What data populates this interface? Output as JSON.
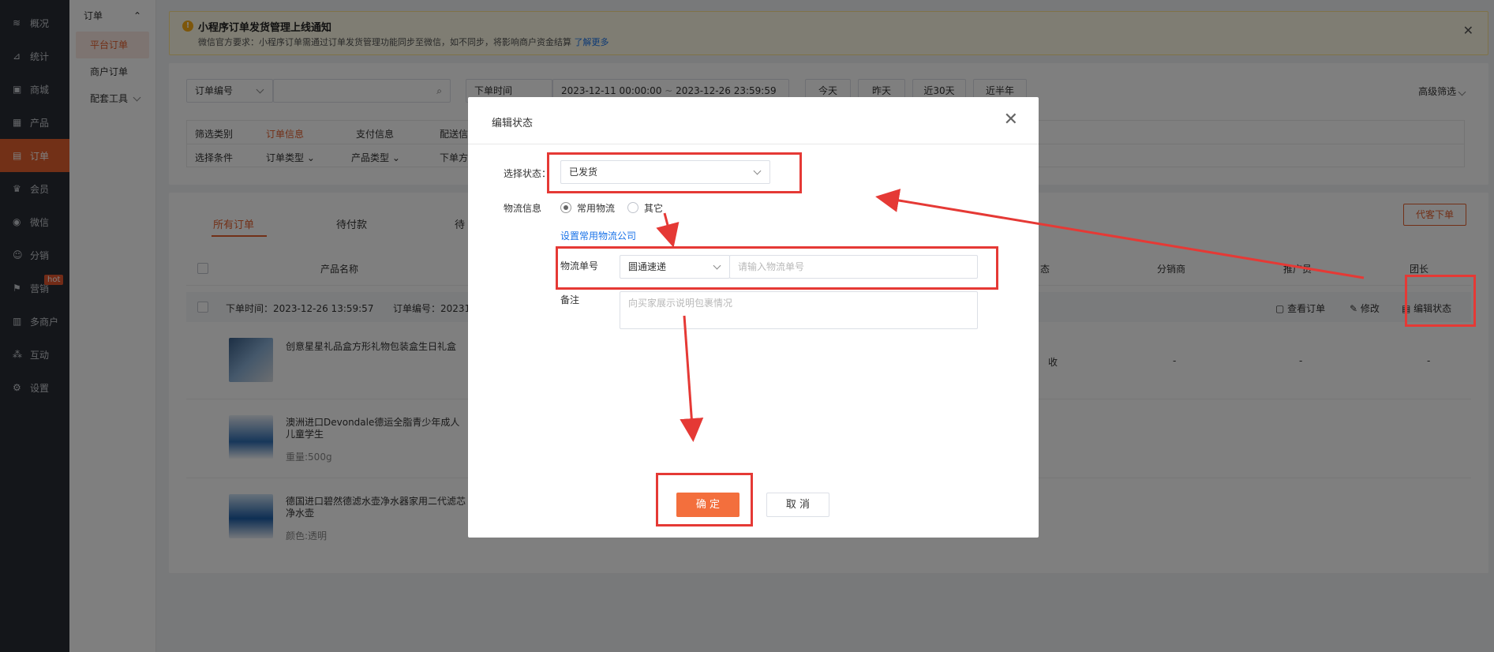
{
  "sidebar": {
    "items": [
      {
        "label": "概况",
        "icon": "layers-icon"
      },
      {
        "label": "统计",
        "icon": "chart-icon"
      },
      {
        "label": "商城",
        "icon": "shop-icon"
      },
      {
        "label": "产品",
        "icon": "grid-icon"
      },
      {
        "label": "订单",
        "icon": "order-icon"
      },
      {
        "label": "会员",
        "icon": "crown-icon"
      },
      {
        "label": "微信",
        "icon": "wechat-icon"
      },
      {
        "label": "分销",
        "icon": "user-share-icon"
      },
      {
        "label": "营销",
        "icon": "flag-icon"
      },
      {
        "label": "多商户",
        "icon": "store-icon"
      },
      {
        "label": "互动",
        "icon": "interact-icon"
      },
      {
        "label": "设置",
        "icon": "gear-icon"
      }
    ],
    "hot_badge": "hot"
  },
  "submenu": {
    "title": "订单",
    "items": [
      "平台订单",
      "商户订单",
      "配套工具"
    ]
  },
  "notice": {
    "title": "小程序订单发货管理上线通知",
    "desc": "微信官方要求：小程序订单需通过订单发货管理功能同步至微信，如不同步，将影响商户资金结算",
    "link": "了解更多"
  },
  "filters": {
    "order_field": "订单编号",
    "time_field": "下单时间",
    "date_start": "2023-12-11 00:00:00",
    "date_sep": "~",
    "date_end": "2023-12-26 23:59:59",
    "quick": [
      "今天",
      "昨天",
      "近30天",
      "近半年"
    ],
    "advanced": "高级筛选",
    "row1_label": "筛选类别",
    "row1_items": [
      "订单信息",
      "支付信息",
      "配送信"
    ],
    "row2_label": "选择条件",
    "row2_items": [
      "订单类型",
      "产品类型",
      "下单方"
    ]
  },
  "orders": {
    "tabs": [
      "所有订单",
      "待付款",
      "待"
    ],
    "proxy_order": "代客下单",
    "columns": [
      "产品名称",
      "态",
      "分销商",
      "推广员",
      "团长"
    ],
    "group_time": "下单时间：2023-12-26 13:59:57",
    "group_no": "订单编号：20231",
    "actions": [
      "查看订单",
      "修改",
      "编辑状态"
    ],
    "products": [
      {
        "name": "创意星星礼品盒方形礼物包装盒生日礼盒",
        "spec": ""
      },
      {
        "name": "澳洲进口Devondale德运全脂青少年成人儿童学生",
        "spec": "重量:500g"
      },
      {
        "name": "德国进口碧然德滤水壶净水器家用二代滤芯净水壶",
        "spec": "颜色:透明"
      }
    ],
    "row1_cells": [
      "收",
      "-",
      "-",
      "-"
    ]
  },
  "modal": {
    "title": "编辑状态",
    "status_label": "选择状态：",
    "status_value": "已发货",
    "logistics_label": "物流信息",
    "radio_common": "常用物流",
    "radio_other": "其它",
    "set_company_link": "设置常用物流公司",
    "tracking_label": "物流单号",
    "carrier_value": "圆通速递",
    "tracking_placeholder": "请输入物流单号",
    "remark_label": "备注",
    "remark_placeholder": "向买家展示说明包裹情况",
    "ok": "确 定",
    "cancel": "取 消"
  },
  "colors": {
    "accent": "#e4602f",
    "annotation": "#e53935",
    "sidebar": "#282c34"
  }
}
